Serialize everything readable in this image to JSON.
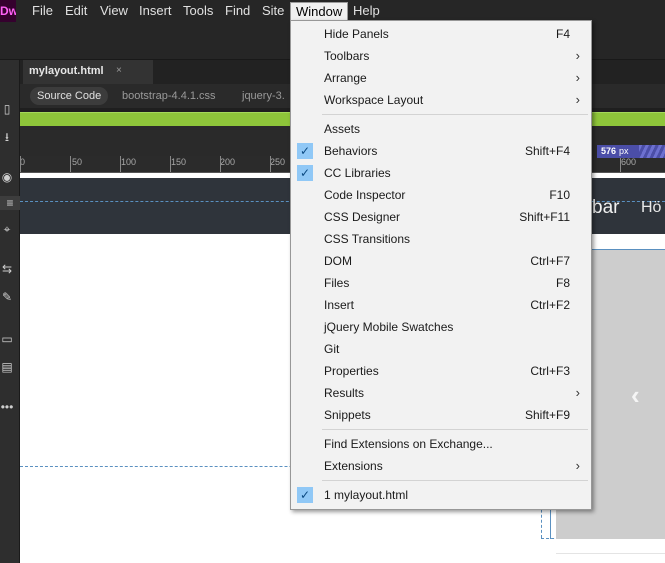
{
  "app": {
    "logo_text": "Dw",
    "menu": [
      "File",
      "Edit",
      "View",
      "Insert",
      "Tools",
      "Find",
      "Site",
      "Window",
      "Help"
    ],
    "active_menu": "Window"
  },
  "document": {
    "tab_title": "mylayout.html",
    "tab_close": "×",
    "related_files": [
      "Source Code",
      "bootstrap-4.4.1.css",
      "jquery-3."
    ]
  },
  "ruler": {
    "labels": [
      "0",
      "50",
      "100",
      "150",
      "200",
      "250",
      "600"
    ],
    "width_readout": "576",
    "width_unit": "px"
  },
  "canvas": {
    "brand_text": "bar",
    "nav_item": "Hö",
    "carousel_prev": "‹"
  },
  "dropdown": {
    "check_glyph": "✓",
    "submenu_glyph": "›",
    "groups": [
      [
        {
          "label": "Hide Panels",
          "shortcut": "F4",
          "checked": false,
          "submenu": false
        },
        {
          "label": "Toolbars",
          "shortcut": "",
          "checked": false,
          "submenu": true
        },
        {
          "label": "Arrange",
          "shortcut": "",
          "checked": false,
          "submenu": true
        },
        {
          "label": "Workspace Layout",
          "shortcut": "",
          "checked": false,
          "submenu": true
        }
      ],
      [
        {
          "label": "Assets",
          "shortcut": "",
          "checked": false,
          "submenu": false
        },
        {
          "label": "Behaviors",
          "shortcut": "Shift+F4",
          "checked": true,
          "submenu": false
        },
        {
          "label": "CC Libraries",
          "shortcut": "",
          "checked": true,
          "submenu": false
        },
        {
          "label": "Code Inspector",
          "shortcut": "F10",
          "checked": false,
          "submenu": false
        },
        {
          "label": "CSS Designer",
          "shortcut": "Shift+F11",
          "checked": false,
          "submenu": false
        },
        {
          "label": "CSS Transitions",
          "shortcut": "",
          "checked": false,
          "submenu": false
        },
        {
          "label": "DOM",
          "shortcut": "Ctrl+F7",
          "checked": false,
          "submenu": false
        },
        {
          "label": "Files",
          "shortcut": "F8",
          "checked": false,
          "submenu": false
        },
        {
          "label": "Insert",
          "shortcut": "Ctrl+F2",
          "checked": false,
          "submenu": false
        },
        {
          "label": "jQuery Mobile Swatches",
          "shortcut": "",
          "checked": false,
          "submenu": false
        },
        {
          "label": "Git",
          "shortcut": "",
          "checked": false,
          "submenu": false
        },
        {
          "label": "Properties",
          "shortcut": "Ctrl+F3",
          "checked": false,
          "submenu": false
        },
        {
          "label": "Results",
          "shortcut": "",
          "checked": false,
          "submenu": true
        },
        {
          "label": "Snippets",
          "shortcut": "Shift+F9",
          "checked": false,
          "submenu": false
        }
      ],
      [
        {
          "label": "Find Extensions on Exchange...",
          "shortcut": "",
          "checked": false,
          "submenu": false
        },
        {
          "label": "Extensions",
          "shortcut": "",
          "checked": false,
          "submenu": true
        }
      ],
      [
        {
          "label": "1 mylayout.html",
          "shortcut": "",
          "checked": true,
          "submenu": false
        }
      ]
    ]
  },
  "colors": {
    "menu_bg": "#f2f2f2",
    "check_bg": "#90c8f6",
    "live_view_bar": "#8ec53a",
    "navbar_bg": "#2f343b",
    "width_badge": "#4b4ea8"
  }
}
